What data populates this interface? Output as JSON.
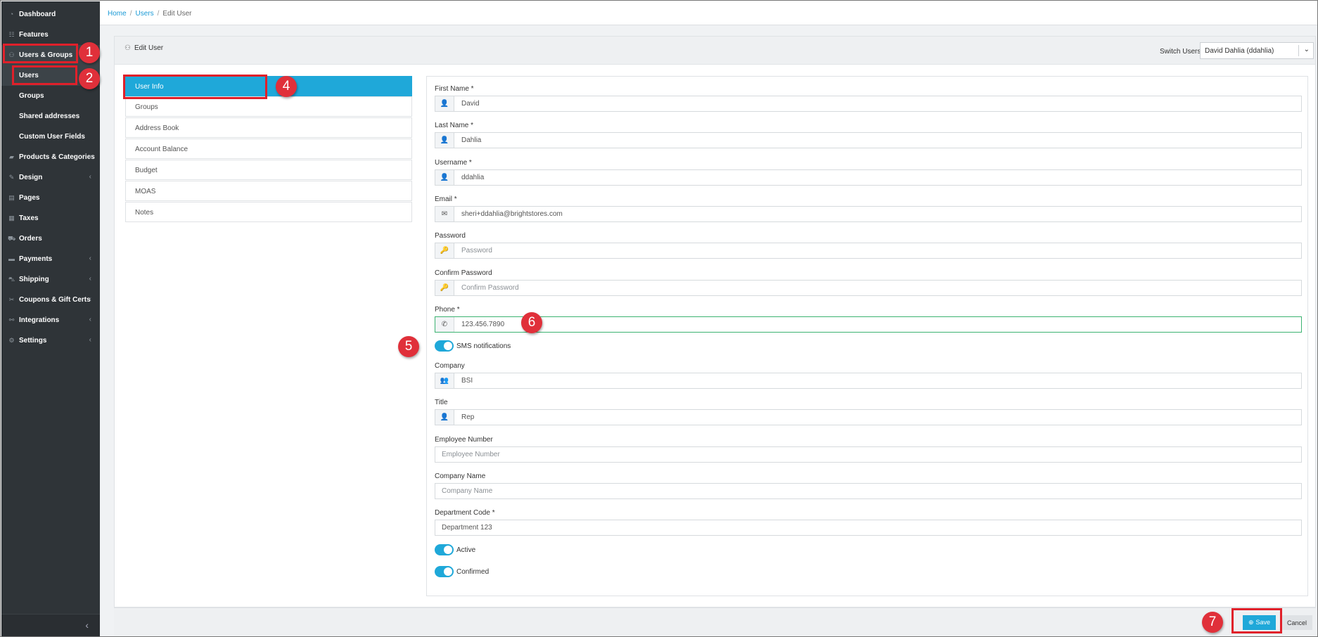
{
  "breadcrumb": {
    "home": "Home",
    "users": "Users",
    "current": "Edit User",
    "sep": "/"
  },
  "sidebar": {
    "items": [
      {
        "label": "Dashboard",
        "icon": "◔",
        "chevron": ""
      },
      {
        "label": "Features",
        "icon": "☷",
        "chevron": ""
      },
      {
        "label": "Users & Groups",
        "icon": "⚇",
        "chevron": ""
      },
      {
        "label": "Users",
        "icon": "",
        "chevron": ""
      },
      {
        "label": "Groups",
        "icon": "",
        "chevron": ""
      },
      {
        "label": "Shared addresses",
        "icon": "",
        "chevron": ""
      },
      {
        "label": "Custom User Fields",
        "icon": "",
        "chevron": ""
      },
      {
        "label": "Products & Categories",
        "icon": "▰",
        "chevron": "‹"
      },
      {
        "label": "Design",
        "icon": "✎",
        "chevron": "‹"
      },
      {
        "label": "Pages",
        "icon": "▤",
        "chevron": ""
      },
      {
        "label": "Taxes",
        "icon": "▦",
        "chevron": ""
      },
      {
        "label": "Orders",
        "icon": "⛟",
        "chevron": ""
      },
      {
        "label": "Payments",
        "icon": "▬",
        "chevron": "‹"
      },
      {
        "label": "Shipping",
        "icon": "⛍",
        "chevron": "‹"
      },
      {
        "label": "Coupons & Gift Certs",
        "icon": "✂",
        "chevron": "‹"
      },
      {
        "label": "Integrations",
        "icon": "⚯",
        "chevron": "‹"
      },
      {
        "label": "Settings",
        "icon": "⚙",
        "chevron": "‹"
      }
    ],
    "collapse_glyph": "‹"
  },
  "panel": {
    "title": "Edit User",
    "title_icon": "⚇",
    "switch_label": "Switch Users",
    "switch_value": "David Dahlia (ddahlia)",
    "switch_chevron": "⌄"
  },
  "tabs": [
    "User Info",
    "Groups",
    "Address Book",
    "Account Balance",
    "Budget",
    "MOAS",
    "Notes"
  ],
  "form": {
    "first_name": {
      "label": "First Name *",
      "value": "David",
      "icon": "👤"
    },
    "last_name": {
      "label": "Last Name *",
      "value": "Dahlia",
      "icon": "👤"
    },
    "username": {
      "label": "Username *",
      "value": "ddahlia",
      "icon": "👤"
    },
    "email": {
      "label": "Email *",
      "value": "sheri+ddahlia@brightstores.com",
      "icon": "✉"
    },
    "password": {
      "label": "Password",
      "placeholder": "Password",
      "icon": "🔑"
    },
    "confirm_password": {
      "label": "Confirm Password",
      "placeholder": "Confirm Password",
      "icon": "🔑"
    },
    "phone": {
      "label": "Phone *",
      "value": "123.456.7890",
      "icon": "✆"
    },
    "sms": {
      "label": "SMS notifications",
      "on": true
    },
    "company": {
      "label": "Company",
      "value": "BSI",
      "icon": "👥"
    },
    "title": {
      "label": "Title",
      "value": "Rep",
      "icon": "👤"
    },
    "employee_number": {
      "label": "Employee Number",
      "placeholder": "Employee Number"
    },
    "company_name": {
      "label": "Company Name",
      "placeholder": "Company Name"
    },
    "department_code": {
      "label": "Department Code *",
      "value": "Department 123"
    },
    "active": {
      "label": "Active",
      "on": true
    },
    "confirmed": {
      "label": "Confirmed",
      "on": true
    }
  },
  "footer": {
    "save": "Save",
    "save_icon": "⊕",
    "cancel": "Cancel"
  },
  "annotations": [
    "1",
    "2",
    "4",
    "5",
    "6",
    "7"
  ],
  "colors": {
    "accent": "#1fa8d9",
    "sidebar": "#2f3438",
    "highlight": "#e0202a"
  }
}
